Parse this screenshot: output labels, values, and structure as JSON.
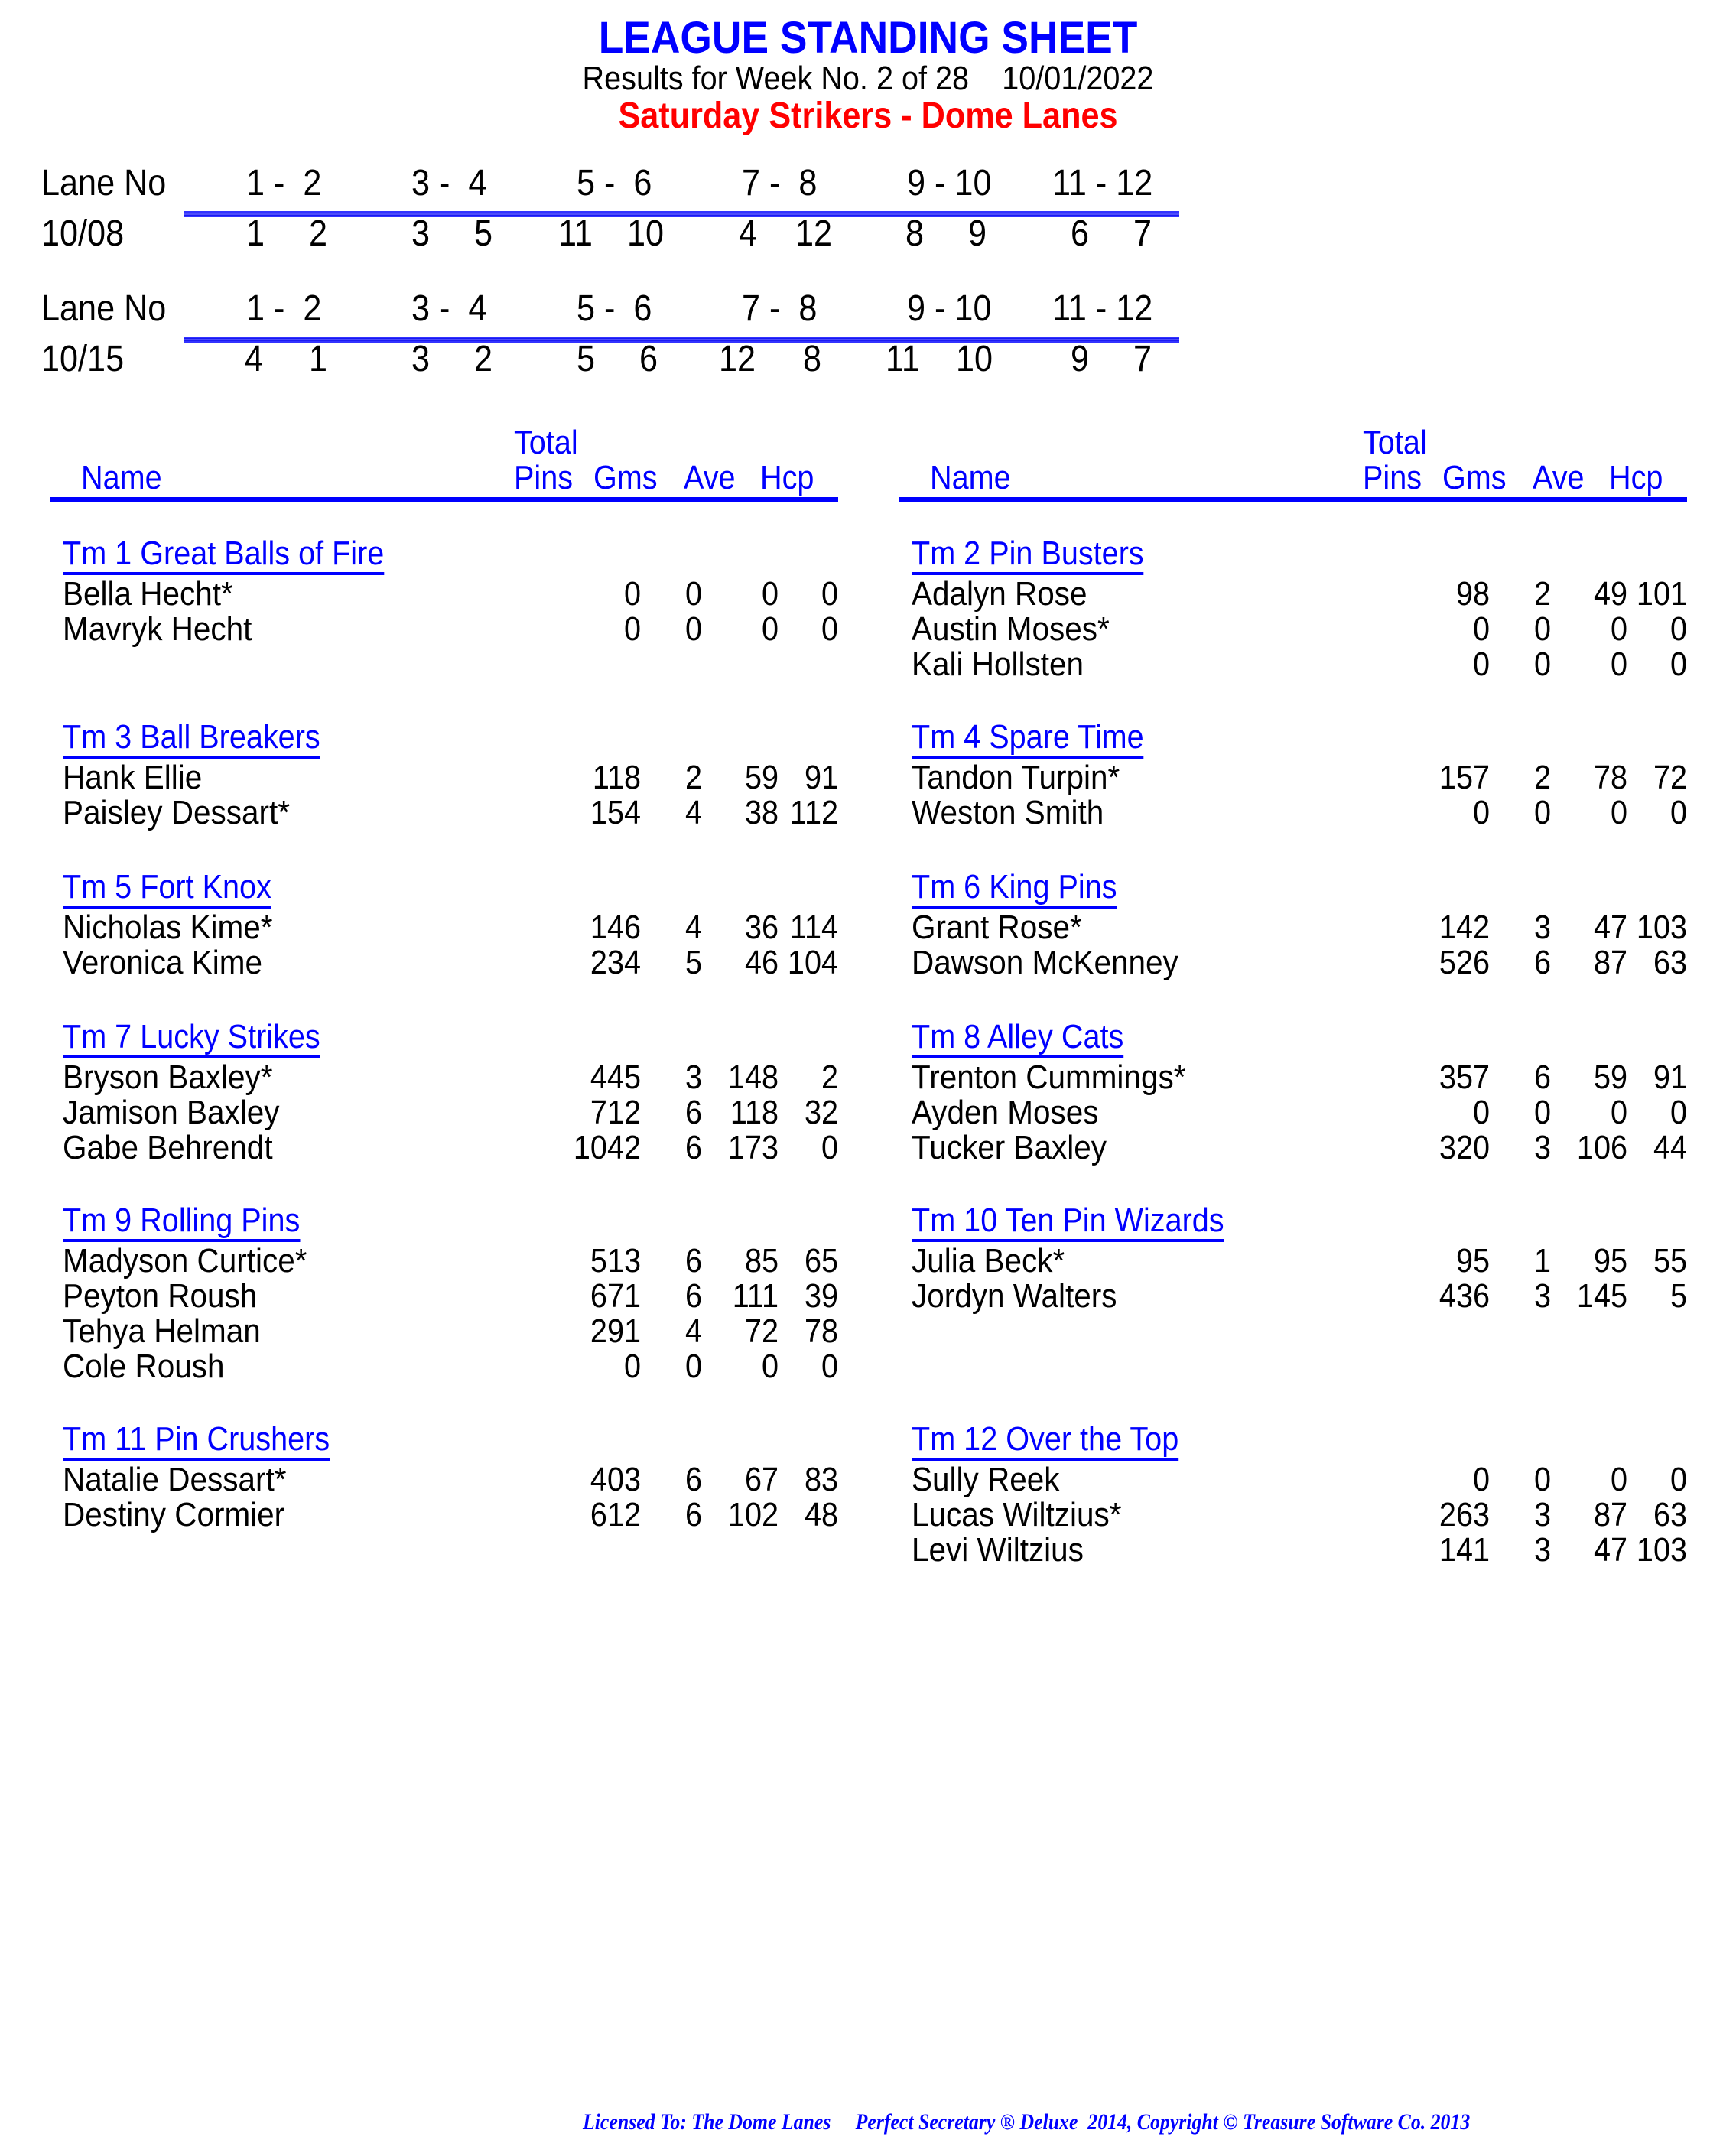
{
  "header": {
    "title": "LEAGUE STANDING SHEET",
    "results_label": "Results for Week No. 2 of 28",
    "date": "10/01/2022",
    "league": "Saturday Strikers - Dome Lanes"
  },
  "colors": {
    "accent_blue": "#0000ff",
    "league_red": "#ff0000"
  },
  "lane_schedules": [
    {
      "header_label": "Lane No",
      "lane_pairs": [
        "1 -  2",
        "3 -  4",
        "5 -  6",
        "7 -  8",
        "9 - 10",
        "11 - 12"
      ],
      "date": "10/08",
      "matchups": [
        [
          "1",
          "2"
        ],
        [
          "3",
          "5"
        ],
        [
          "11",
          "10"
        ],
        [
          "4",
          "12"
        ],
        [
          "8",
          "9"
        ],
        [
          "6",
          "7"
        ]
      ]
    },
    {
      "header_label": "Lane No",
      "lane_pairs": [
        "1 -  2",
        "3 -  4",
        "5 -  6",
        "7 -  8",
        "9 - 10",
        "11 - 12"
      ],
      "date": "10/15",
      "matchups": [
        [
          "4",
          "1"
        ],
        [
          "3",
          "2"
        ],
        [
          "5",
          "6"
        ],
        [
          "12",
          "8"
        ],
        [
          "11",
          "10"
        ],
        [
          "9",
          "7"
        ]
      ]
    }
  ],
  "columns": {
    "name": "Name",
    "total": "Total",
    "pins": "Pins",
    "gms": "Gms",
    "ave": "Ave",
    "hcp": "Hcp"
  },
  "teams": [
    {
      "name": "Tm 1 Great Balls of Fire",
      "bowlers": [
        {
          "name": "Bella Hecht*",
          "pins": "0",
          "gms": "0",
          "ave": "0",
          "hcp": "0"
        },
        {
          "name": "Mavryk Hecht",
          "pins": "0",
          "gms": "0",
          "ave": "0",
          "hcp": "0"
        }
      ]
    },
    {
      "name": "Tm 2 Pin Busters",
      "bowlers": [
        {
          "name": "Adalyn Rose",
          "pins": "98",
          "gms": "2",
          "ave": "49",
          "hcp": "101"
        },
        {
          "name": "Austin Moses*",
          "pins": "0",
          "gms": "0",
          "ave": "0",
          "hcp": "0"
        },
        {
          "name": "Kali Hollsten",
          "pins": "0",
          "gms": "0",
          "ave": "0",
          "hcp": "0"
        }
      ]
    },
    {
      "name": "Tm 3 Ball Breakers",
      "bowlers": [
        {
          "name": "Hank Ellie",
          "pins": "118",
          "gms": "2",
          "ave": "59",
          "hcp": "91"
        },
        {
          "name": "Paisley Dessart*",
          "pins": "154",
          "gms": "4",
          "ave": "38",
          "hcp": "112"
        }
      ]
    },
    {
      "name": "Tm 4 Spare Time",
      "bowlers": [
        {
          "name": "Tandon Turpin*",
          "pins": "157",
          "gms": "2",
          "ave": "78",
          "hcp": "72"
        },
        {
          "name": "Weston Smith",
          "pins": "0",
          "gms": "0",
          "ave": "0",
          "hcp": "0"
        }
      ]
    },
    {
      "name": "Tm 5 Fort Knox",
      "bowlers": [
        {
          "name": "Nicholas Kime*",
          "pins": "146",
          "gms": "4",
          "ave": "36",
          "hcp": "114"
        },
        {
          "name": "Veronica Kime",
          "pins": "234",
          "gms": "5",
          "ave": "46",
          "hcp": "104"
        }
      ]
    },
    {
      "name": "Tm 6 King Pins",
      "bowlers": [
        {
          "name": "Grant Rose*",
          "pins": "142",
          "gms": "3",
          "ave": "47",
          "hcp": "103"
        },
        {
          "name": "Dawson McKenney",
          "pins": "526",
          "gms": "6",
          "ave": "87",
          "hcp": "63"
        }
      ]
    },
    {
      "name": "Tm 7 Lucky Strikes",
      "bowlers": [
        {
          "name": "Bryson Baxley*",
          "pins": "445",
          "gms": "3",
          "ave": "148",
          "hcp": "2"
        },
        {
          "name": "Jamison Baxley",
          "pins": "712",
          "gms": "6",
          "ave": "118",
          "hcp": "32"
        },
        {
          "name": "Gabe Behrendt",
          "pins": "1042",
          "gms": "6",
          "ave": "173",
          "hcp": "0"
        }
      ]
    },
    {
      "name": "Tm 8 Alley Cats",
      "bowlers": [
        {
          "name": "Trenton Cummings*",
          "pins": "357",
          "gms": "6",
          "ave": "59",
          "hcp": "91"
        },
        {
          "name": "Ayden Moses",
          "pins": "0",
          "gms": "0",
          "ave": "0",
          "hcp": "0"
        },
        {
          "name": "Tucker Baxley",
          "pins": "320",
          "gms": "3",
          "ave": "106",
          "hcp": "44"
        }
      ]
    },
    {
      "name": "Tm 9 Rolling Pins",
      "bowlers": [
        {
          "name": "Madyson Curtice*",
          "pins": "513",
          "gms": "6",
          "ave": "85",
          "hcp": "65"
        },
        {
          "name": "Peyton Roush",
          "pins": "671",
          "gms": "6",
          "ave": "111",
          "hcp": "39"
        },
        {
          "name": "Tehya Helman",
          "pins": "291",
          "gms": "4",
          "ave": "72",
          "hcp": "78"
        },
        {
          "name": "Cole Roush",
          "pins": "0",
          "gms": "0",
          "ave": "0",
          "hcp": "0"
        }
      ]
    },
    {
      "name": "Tm 10 Ten Pin Wizards",
      "bowlers": [
        {
          "name": "Julia Beck*",
          "pins": "95",
          "gms": "1",
          "ave": "95",
          "hcp": "55"
        },
        {
          "name": "Jordyn Walters",
          "pins": "436",
          "gms": "3",
          "ave": "145",
          "hcp": "5"
        }
      ]
    },
    {
      "name": "Tm 11 Pin Crushers",
      "bowlers": [
        {
          "name": "Natalie Dessart*",
          "pins": "403",
          "gms": "6",
          "ave": "67",
          "hcp": "83"
        },
        {
          "name": "Destiny Cormier",
          "pins": "612",
          "gms": "6",
          "ave": "102",
          "hcp": "48"
        }
      ]
    },
    {
      "name": "Tm 12 Over the Top",
      "bowlers": [
        {
          "name": "Sully Reek",
          "pins": "0",
          "gms": "0",
          "ave": "0",
          "hcp": "0"
        },
        {
          "name": "Lucas Wiltzius*",
          "pins": "263",
          "gms": "3",
          "ave": "87",
          "hcp": "63"
        },
        {
          "name": "Levi Wiltzius",
          "pins": "141",
          "gms": "3",
          "ave": "47",
          "hcp": "103"
        }
      ]
    }
  ],
  "footer": {
    "licensed": "Licensed To: The Dome Lanes",
    "product": "Perfect Secretary ® Deluxe  2014, Copyright © Treasure Software Co. 2013"
  }
}
